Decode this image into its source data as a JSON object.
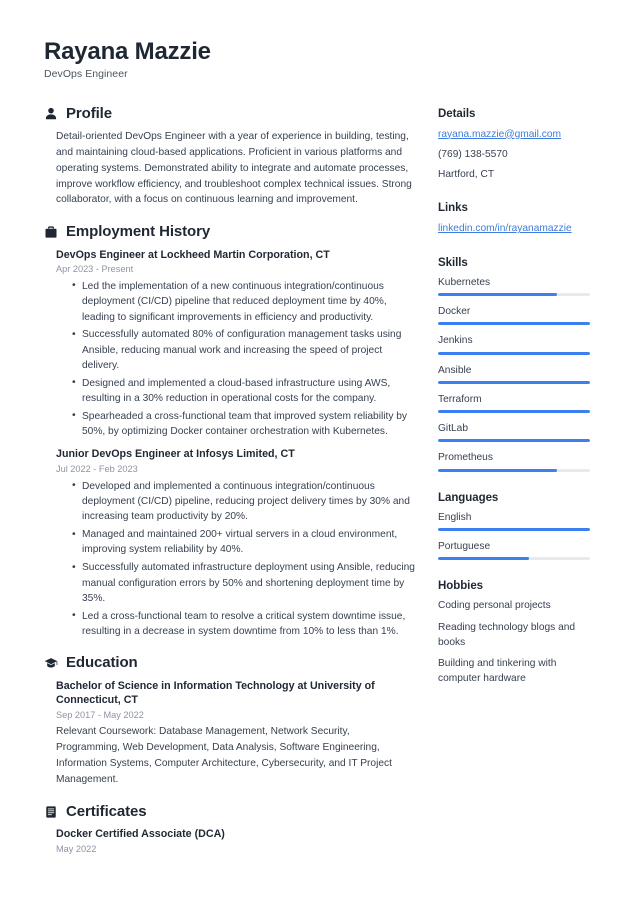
{
  "header": {
    "name": "Rayana Mazzie",
    "job_title": "DevOps Engineer"
  },
  "theme": {
    "accent": "#3b7ff0",
    "link": "#3d7bdc",
    "text": "#374151",
    "heading": "#1f2733",
    "muted": "#8d95a3",
    "track": "#e8eaee"
  },
  "main": {
    "profile": {
      "icon": "user-icon",
      "title": "Profile",
      "text": "Detail-oriented DevOps Engineer with a year of experience in building, testing, and maintaining cloud-based applications. Proficient in various platforms and operating systems. Demonstrated ability to integrate and automate processes, improve workflow efficiency, and troubleshoot complex technical issues. Strong collaborator, with a focus on continuous learning and improvement."
    },
    "employment": {
      "icon": "briefcase-icon",
      "title": "Employment History",
      "entries": [
        {
          "title": "DevOps Engineer at Lockheed Martin Corporation, CT",
          "date": "Apr 2023 - Present",
          "bullets": [
            "Led the implementation of a new continuous integration/continuous deployment (CI/CD) pipeline that reduced deployment time by 40%, leading to significant improvements in efficiency and productivity.",
            "Successfully automated 80% of configuration management tasks using Ansible, reducing manual work and increasing the speed of project delivery.",
            "Designed and implemented a cloud-based infrastructure using AWS, resulting in a 30% reduction in operational costs for the company.",
            "Spearheaded a cross-functional team that improved system reliability by 50%, by optimizing Docker container orchestration with Kubernetes."
          ]
        },
        {
          "title": "Junior DevOps Engineer at Infosys Limited, CT",
          "date": "Jul 2022 - Feb 2023",
          "bullets": [
            "Developed and implemented a continuous integration/continuous deployment (CI/CD) pipeline, reducing project delivery times by 30% and increasing team productivity by 20%.",
            "Managed and maintained 200+ virtual servers in a cloud environment, improving system reliability by 40%.",
            "Successfully automated infrastructure deployment using Ansible, reducing manual configuration errors by 50% and shortening deployment time by 35%.",
            "Led a cross-functional team to resolve a critical system downtime issue, resulting in a decrease in system downtime from 10% to less than 1%."
          ]
        }
      ]
    },
    "education": {
      "icon": "graduation-cap-icon",
      "title": "Education",
      "entries": [
        {
          "title": "Bachelor of Science in Information Technology at University of Connecticut, CT",
          "date": "Sep 2017 - May 2022",
          "description": "Relevant Coursework: Database Management, Network Security, Programming, Web Development, Data Analysis, Software Engineering, Information Systems, Computer Architecture, Cybersecurity, and IT Project Management."
        }
      ]
    },
    "certificates": {
      "icon": "certificate-icon",
      "title": "Certificates",
      "entries": [
        {
          "title": "Docker Certified Associate (DCA)",
          "date": "May 2022"
        }
      ]
    }
  },
  "sidebar": {
    "details": {
      "title": "Details",
      "email": "rayana.mazzie@gmail.com",
      "phone": "(769) 138-5570",
      "location": "Hartford, CT"
    },
    "links": {
      "title": "Links",
      "items": [
        {
          "label": "linkedin.com/in/rayanamazzie"
        }
      ]
    },
    "skills": {
      "title": "Skills",
      "items": [
        {
          "name": "Kubernetes",
          "level": 78
        },
        {
          "name": "Docker",
          "level": 100
        },
        {
          "name": "Jenkins",
          "level": 100
        },
        {
          "name": "Ansible",
          "level": 100
        },
        {
          "name": "Terraform",
          "level": 100
        },
        {
          "name": "GitLab",
          "level": 100
        },
        {
          "name": "Prometheus",
          "level": 78
        }
      ]
    },
    "languages": {
      "title": "Languages",
      "items": [
        {
          "name": "English",
          "level": 100
        },
        {
          "name": "Portuguese",
          "level": 60
        }
      ]
    },
    "hobbies": {
      "title": "Hobbies",
      "items": [
        {
          "label": "Coding personal projects"
        },
        {
          "label": "Reading technology blogs and books"
        },
        {
          "label": "Building and tinkering with computer hardware"
        }
      ]
    }
  }
}
